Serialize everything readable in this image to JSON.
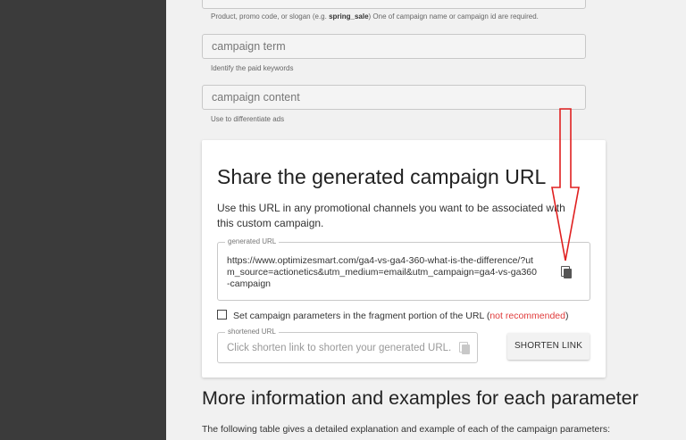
{
  "fields": {
    "campaign_name_hint": "Product, promo code, or slogan (e.g. ",
    "campaign_name_example": "spring_sale",
    "campaign_name_hint_tail": ") One of campaign name or campaign id are required.",
    "term_placeholder": "campaign term",
    "term_hint": "Identify the paid keywords",
    "content_placeholder": "campaign content",
    "content_hint": "Use to differentiate ads"
  },
  "share_card": {
    "title": "Share the generated campaign URL",
    "description": "Use this URL in any promotional channels you want to be associated with this custom campaign.",
    "generated_url_label": "generated URL",
    "generated_url": "https://www.optimizesmart.com/ga4-vs-ga4-360-what-is-the-difference/?utm_source=actionetics&utm_medium=email&utm_campaign=ga4-vs-ga360-campaign",
    "fragment_checkbox_label": "Set campaign parameters in the fragment portion of the URL (",
    "not_recommended": "not recommended",
    "fragment_close": ")",
    "shortened_url_label": "shortened URL",
    "shortened_placeholder": "Click shorten link to shorten your generated URL.",
    "shorten_button": "SHORTEN LINK"
  },
  "more_info": {
    "heading": "More information and examples for each parameter",
    "intro": "The following table gives a detailed explanation and example of each of the campaign parameters:"
  },
  "colors": {
    "sidebar": "#3b3b3b",
    "background": "#f1f1f1",
    "annotation_arrow": "#e02020",
    "not_recommended": "#e03b3b"
  },
  "icons": [
    "copy-icon"
  ]
}
